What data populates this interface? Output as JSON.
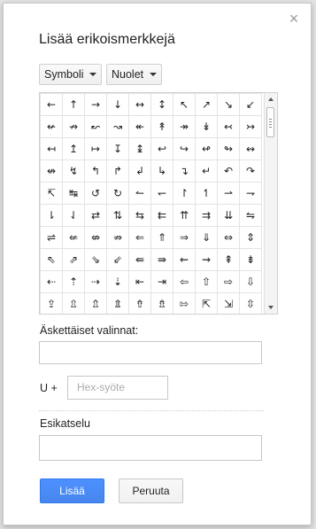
{
  "dialog": {
    "title": "Lisää erikoismerkkejä",
    "close_glyph": "×"
  },
  "filters": {
    "category": "Symboli",
    "subcategory": "Nuolet"
  },
  "grid": {
    "rows": [
      [
        "←",
        "↑",
        "→",
        "↓",
        "↔",
        "↕",
        "↖",
        "↗",
        "↘",
        "↙"
      ],
      [
        "↚",
        "↛",
        "↜",
        "↝",
        "↞",
        "↟",
        "↠",
        "↡",
        "↢",
        "↣"
      ],
      [
        "↤",
        "↥",
        "↦",
        "↧",
        "↨",
        "↩",
        "↪",
        "↫",
        "↬",
        "↭"
      ],
      [
        "↮",
        "↯",
        "↰",
        "↱",
        "↲",
        "↳",
        "↴",
        "↵",
        "↶",
        "↷"
      ],
      [
        "↸",
        "↹",
        "↺",
        "↻",
        "↼",
        "↽",
        "↾",
        "↿",
        "⇀",
        "⇁"
      ],
      [
        "⇂",
        "⇃",
        "⇄",
        "⇅",
        "⇆",
        "⇇",
        "⇈",
        "⇉",
        "⇊",
        "⇋"
      ],
      [
        "⇌",
        "⇍",
        "⇎",
        "⇏",
        "⇐",
        "⇑",
        "⇒",
        "⇓",
        "⇔",
        "⇕"
      ],
      [
        "⇖",
        "⇗",
        "⇘",
        "⇙",
        "⇚",
        "⇛",
        "⇜",
        "⇝",
        "⇞",
        "⇟"
      ],
      [
        "⇠",
        "⇡",
        "⇢",
        "⇣",
        "⇤",
        "⇥",
        "⇦",
        "⇧",
        "⇨",
        "⇩"
      ],
      [
        "⇪",
        "⇫",
        "⇬",
        "⇭",
        "⇮",
        "⇯",
        "⇰",
        "⇱",
        "⇲",
        "⇳"
      ]
    ]
  },
  "recent": {
    "label": "Äskettäiset valinnat:"
  },
  "hex": {
    "prefix": "U +",
    "placeholder": "Hex-syöte"
  },
  "preview": {
    "label": "Esikatselu"
  },
  "buttons": {
    "insert": "Lisää",
    "cancel": "Peruuta"
  }
}
